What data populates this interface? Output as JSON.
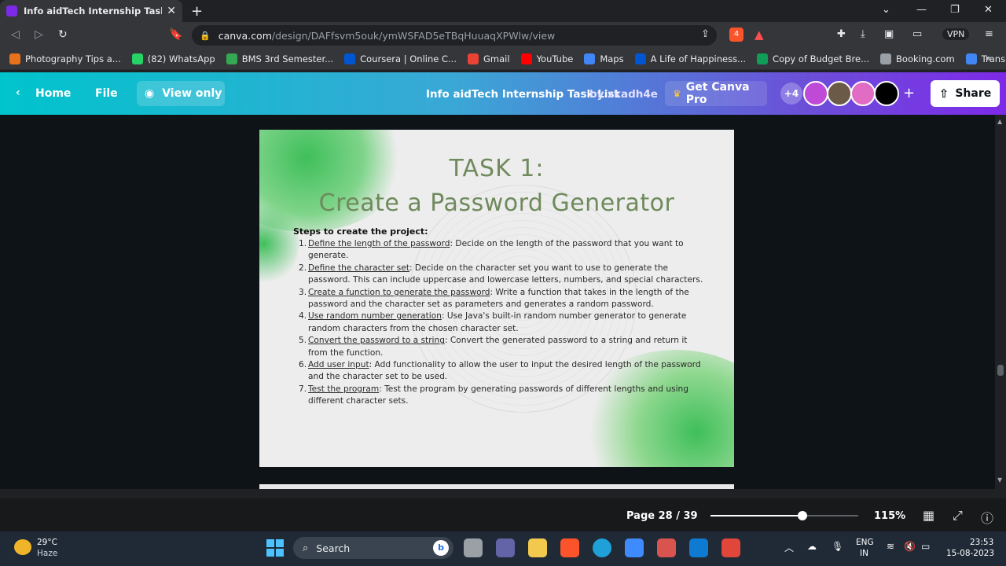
{
  "browser": {
    "tab_title": "Info aidTech Internship Task List -",
    "tab_close": "✕",
    "new_tab": "+",
    "url_host": "canva.com",
    "url_path": "/design/DAFfsvm5ouk/ymWSFAD5eTBqHuuaqXPWlw/view",
    "vpn_label": "VPN",
    "brave_badge": "4",
    "bookmarks": [
      {
        "label": "Photography Tips a...",
        "color": "#e8711c"
      },
      {
        "label": "(82) WhatsApp",
        "color": "#25d366"
      },
      {
        "label": "BMS 3rd Semester...",
        "color": "#34a853"
      },
      {
        "label": "Coursera | Online C...",
        "color": "#0056d2"
      },
      {
        "label": "Gmail",
        "color": "#ea4335"
      },
      {
        "label": "YouTube",
        "color": "#ff0000"
      },
      {
        "label": "Maps",
        "color": "#4285f4"
      },
      {
        "label": "A Life of Happiness...",
        "color": "#0056d2"
      },
      {
        "label": "Copy of Budget Bre...",
        "color": "#0f9d58"
      },
      {
        "label": "Booking.com",
        "color": "#9aa0a6"
      },
      {
        "label": "Translate",
        "color": "#4285f4"
      }
    ]
  },
  "canva": {
    "home_label": "Home",
    "file_label": "File",
    "view_only_label": "View only",
    "doc_title": "Info aidTech Internship Task List",
    "doc_by": "by zkadh4e",
    "get_pro_label": "Get Canva Pro",
    "collab_count": "+4",
    "share_label": "Share",
    "page_label": "Page 28 / 39",
    "zoom_label": "115%",
    "zoom_fraction": 0.59
  },
  "slide": {
    "title_line1": "TASK 1:",
    "title_line2": "Create a Password Generator",
    "steps_heading": "Steps to create the project:",
    "steps": [
      {
        "num": "1.",
        "term": "Define the length of the password",
        "text": ": Decide on the length of the password that you want to generate."
      },
      {
        "num": "2.",
        "term": "Define the character set",
        "text": ": Decide on the character set you want to use to generate the password. This can include uppercase and lowercase letters, numbers, and special characters."
      },
      {
        "num": "3.",
        "term": "Create a function to generate the password",
        "text": ": Write a function that takes in the length of the password and the character set as parameters and generates a random password."
      },
      {
        "num": "4.",
        "term": "Use random number generation",
        "text": ": Use Java's built-in random number generator to generate random characters from the chosen character set."
      },
      {
        "num": "5.",
        "term": "Convert the password to a string",
        "text": ": Convert the generated password to a string and return it from the function."
      },
      {
        "num": "6.",
        "term": "Add user input",
        "text": ": Add functionality to allow the user to input the desired length of the password and the character set to be used."
      },
      {
        "num": "7.",
        "term": "Test the program",
        "text": ": Test the program by generating passwords of different lengths and using different character sets."
      }
    ]
  },
  "taskbar": {
    "weather_temp": "29°C",
    "weather_desc": "Haze",
    "search_label": "Search",
    "lang_1": "ENG",
    "lang_2": "IN",
    "time": "23:53",
    "date": "15-08-2023"
  }
}
